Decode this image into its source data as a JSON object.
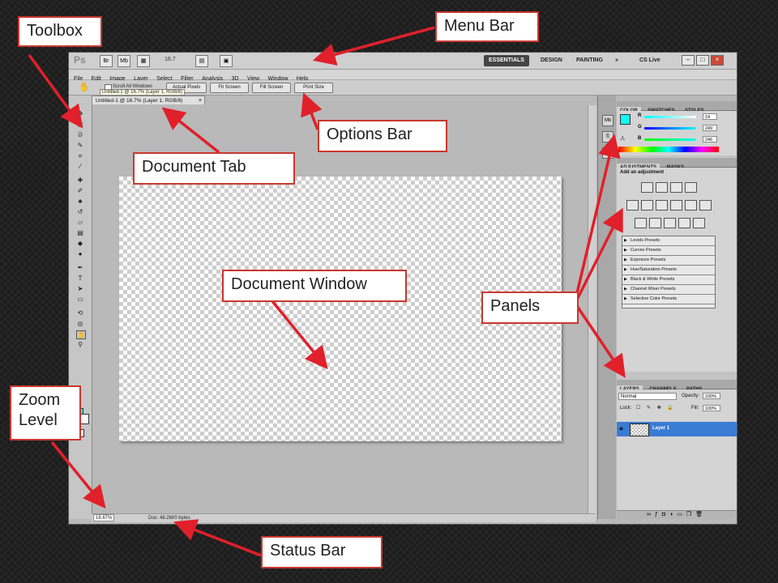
{
  "callouts": {
    "toolbox": "Toolbox",
    "menu_bar": "Menu Bar",
    "options_bar": "Options Bar",
    "document_tab": "Document Tab",
    "document_window": "Document Window",
    "panels": "Panels",
    "zoom_level_line1": "Zoom",
    "zoom_level_line2": "Level",
    "status_bar": "Status Bar"
  },
  "app": {
    "logo": "Ps",
    "zoom_value": "16.7",
    "workspaces": [
      "ESSENTIALS",
      "DESIGN",
      "PAINTING"
    ],
    "more": "»",
    "cs_live": "CS Live"
  },
  "menu": [
    "File",
    "Edit",
    "Image",
    "Layer",
    "Select",
    "Filter",
    "Analysis",
    "3D",
    "View",
    "Window",
    "Help"
  ],
  "options": {
    "scroll_all": "Scroll All Windows",
    "buttons": [
      "Actual Pixels",
      "Fit Screen",
      "Fill Screen",
      "Print Size"
    ],
    "tooltip": "Untitled-1 @ 16.7% (Layer 1, RGB/8)"
  },
  "document": {
    "tab_label": "Untitled-1 @ 16.7% (Layer 1, RGB/8)",
    "tab_close": "×"
  },
  "status": {
    "zoom": "16.67%",
    "doc_size": "Doc: 48.2M/0 bytes"
  },
  "color_panel": {
    "tabs": [
      "COLOR",
      "SWATCHES",
      "STYLES"
    ],
    "r_label": "R",
    "g_label": "G",
    "b_label": "B",
    "r": "14",
    "g": "249",
    "b": "246",
    "fg_color": "#14f9f6"
  },
  "adjustments_panel": {
    "tabs": [
      "ADJUSTMENTS",
      "MASKS"
    ],
    "title": "Add an adjustment",
    "presets": [
      "Levels Presets",
      "Curves Presets",
      "Exposure Presets",
      "Hue/Saturation Presets",
      "Black & White Presets",
      "Channel Mixer Presets",
      "Selective Color Presets"
    ]
  },
  "layers_panel": {
    "tabs": [
      "LAYERS",
      "CHANNELS",
      "PATHS"
    ],
    "blend_mode": "Normal",
    "opacity_label": "Opacity:",
    "opacity": "100%",
    "lock_label": "Lock:",
    "fill_label": "Fill:",
    "fill": "100%",
    "layer_name": "Layer 1"
  },
  "colors": {
    "callout_border": "#c8382e",
    "arrow": "#e0202a",
    "layer_selected": "#3a7bd5"
  }
}
